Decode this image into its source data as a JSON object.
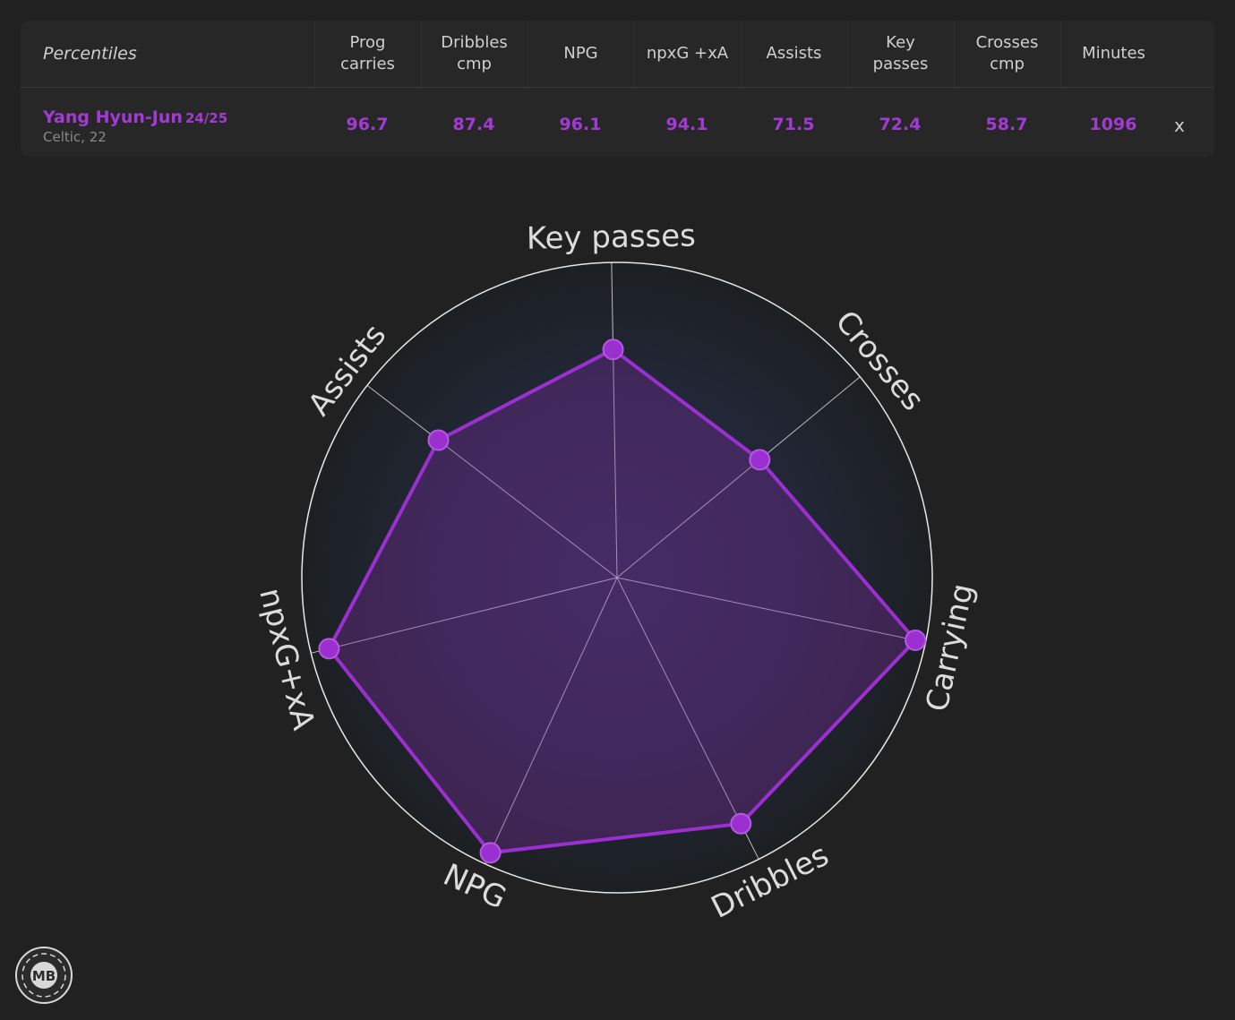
{
  "table": {
    "title": "Percentiles",
    "headers": [
      "Prog\ncarries",
      "Dribbles\ncmp",
      "NPG",
      "npxG +xA",
      "Assists",
      "Key\npasses",
      "Crosses\ncmp",
      "Minutes"
    ],
    "player": {
      "name": "Yang Hyun-Jun",
      "season": "24/25",
      "sub": "Celtic, 22",
      "values": [
        "96.7",
        "87.4",
        "96.1",
        "94.1",
        "71.5",
        "72.4",
        "58.7",
        "1096"
      ]
    },
    "remove_label": "x"
  },
  "chart_data": {
    "type": "radar",
    "axes": [
      "Key passes",
      "Crosses",
      "Carrying",
      "Dribbles",
      "NPG",
      "npxG+xA",
      "Assists"
    ],
    "series": [
      {
        "values": [
          72.4,
          58.7,
          96.7,
          87.4,
          96.1,
          94.1,
          71.5
        ]
      }
    ],
    "rlim": [
      0,
      100
    ],
    "colors": {
      "line": "#9b2fd0",
      "fill": "#7a2aa0",
      "grid": "#e6e6e6",
      "background": "#1c2022"
    }
  },
  "logo": {
    "text": "MB"
  }
}
